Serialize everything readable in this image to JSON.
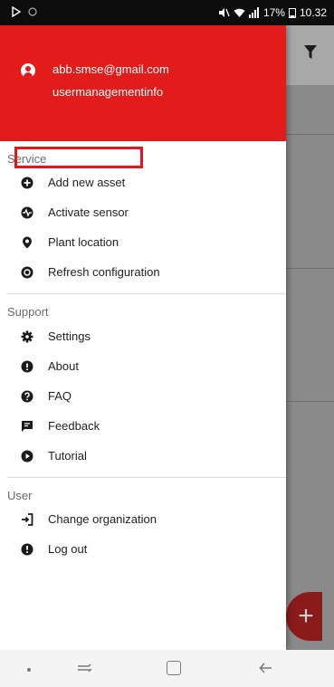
{
  "status_bar": {
    "battery": "17%",
    "time": "10.32"
  },
  "drawer": {
    "header": {
      "email": "abb.smse@gmail.com",
      "org": "usermanagementinfo",
      "color": "#e21b1b"
    },
    "sections": [
      {
        "title": "Service",
        "items": [
          {
            "label": "Add new asset",
            "icon": "plus-circle-icon"
          },
          {
            "label": "Activate sensor",
            "icon": "pulse-icon"
          },
          {
            "label": "Plant location",
            "icon": "map-pin-icon"
          },
          {
            "label": "Refresh configuration",
            "icon": "refresh-icon"
          }
        ]
      },
      {
        "title": "Support",
        "items": [
          {
            "label": "Settings",
            "icon": "gear-icon"
          },
          {
            "label": "About",
            "icon": "info-icon"
          },
          {
            "label": "FAQ",
            "icon": "question-icon"
          },
          {
            "label": "Feedback",
            "icon": "feedback-icon"
          },
          {
            "label": "Tutorial",
            "icon": "play-circle-icon"
          }
        ]
      },
      {
        "title": "User",
        "items": [
          {
            "label": "Change organization",
            "icon": "login-icon"
          },
          {
            "label": "Log out",
            "icon": "logout-icon"
          }
        ]
      }
    ]
  },
  "colors": {
    "accent": "#e21b1b",
    "highlight_box": "#e8131b"
  }
}
